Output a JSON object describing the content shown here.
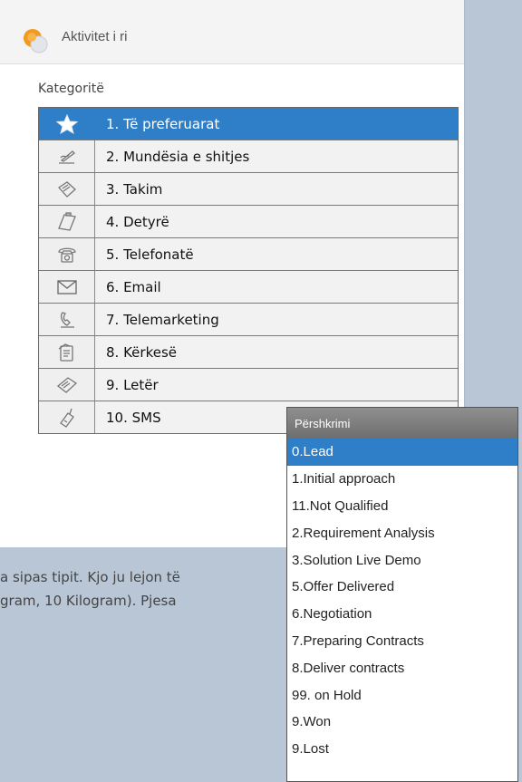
{
  "window": {
    "title": "Aktivitet i ri",
    "icon": "app-logo-icon"
  },
  "categories": {
    "label": "Kategoritë",
    "items": [
      {
        "label": "1. Të preferuarat",
        "icon": "star-icon",
        "selected": true
      },
      {
        "label": "2. Mundësia e shitjes",
        "icon": "opportunity-icon"
      },
      {
        "label": "3. Takim",
        "icon": "meeting-icon"
      },
      {
        "label": "4. Detyrë",
        "icon": "task-icon"
      },
      {
        "label": "5. Telefonatë",
        "icon": "phone-icon"
      },
      {
        "label": "6. Email",
        "icon": "envelope-icon"
      },
      {
        "label": "7. Telemarketing",
        "icon": "telemarketing-icon"
      },
      {
        "label": "8. Kërkesë",
        "icon": "request-icon"
      },
      {
        "label": "9. Letër",
        "icon": "letter-icon"
      },
      {
        "label": "10. SMS",
        "icon": "mobile-phone-icon"
      }
    ]
  },
  "body_text": {
    "line1": "a sipas tipit. Kjo ju lejon të",
    "line2": "gram, 10 Kilogram). Pjesa"
  },
  "dropdown": {
    "header": "Përshkrimi",
    "items": [
      {
        "label": "0.Lead",
        "selected": true
      },
      {
        "label": "1.Initial approach"
      },
      {
        "label": "11.Not Qualified"
      },
      {
        "label": "2.Requirement Analysis"
      },
      {
        "label": "3.Solution Live Demo"
      },
      {
        "label": "5.Offer Delivered"
      },
      {
        "label": "6.Negotiation"
      },
      {
        "label": "7.Preparing Contracts"
      },
      {
        "label": "8.Deliver contracts"
      },
      {
        "label": "99. on Hold"
      },
      {
        "label": "9.Won"
      },
      {
        "label": "9.Lost"
      }
    ]
  },
  "colors": {
    "selection": "#2f7fc8",
    "background": "#b9c6d6"
  }
}
